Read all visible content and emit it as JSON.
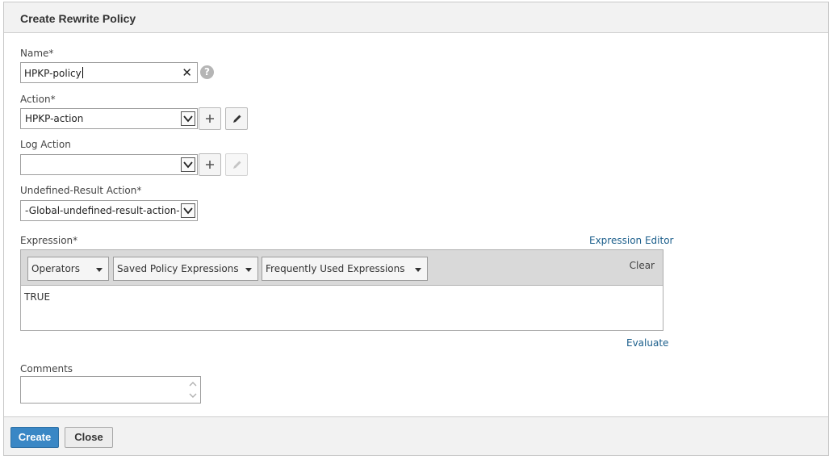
{
  "dialog": {
    "title": "Create Rewrite Policy"
  },
  "name_field": {
    "label": "Name*",
    "value": "HPKP-policy",
    "help_icon": "?"
  },
  "action_field": {
    "label": "Action*",
    "value": "HPKP-action"
  },
  "log_action_field": {
    "label": "Log Action",
    "value": ""
  },
  "undefined_result_field": {
    "label": "Undefined-Result Action*",
    "value": "-Global-undefined-result-action-"
  },
  "expression": {
    "label": "Expression*",
    "editor_link": "Expression Editor",
    "operators": "Operators",
    "saved": "Saved Policy Expressions",
    "frequent": "Frequently Used Expressions",
    "clear": "Clear",
    "value": "TRUE",
    "evaluate_link": "Evaluate"
  },
  "comments_field": {
    "label": "Comments",
    "value": ""
  },
  "footer": {
    "create_label": "Create",
    "close_label": "Close"
  },
  "colors": {
    "primary_button": "#3a87c5",
    "link": "#1b5e8b",
    "header_bg": "#f2f2f2"
  },
  "icons": [
    "clear-x-icon",
    "help-icon",
    "dropdown-chevron-icon",
    "plus-icon",
    "pencil-icon",
    "caret-down-icon",
    "spinner-arrows-icon"
  ]
}
